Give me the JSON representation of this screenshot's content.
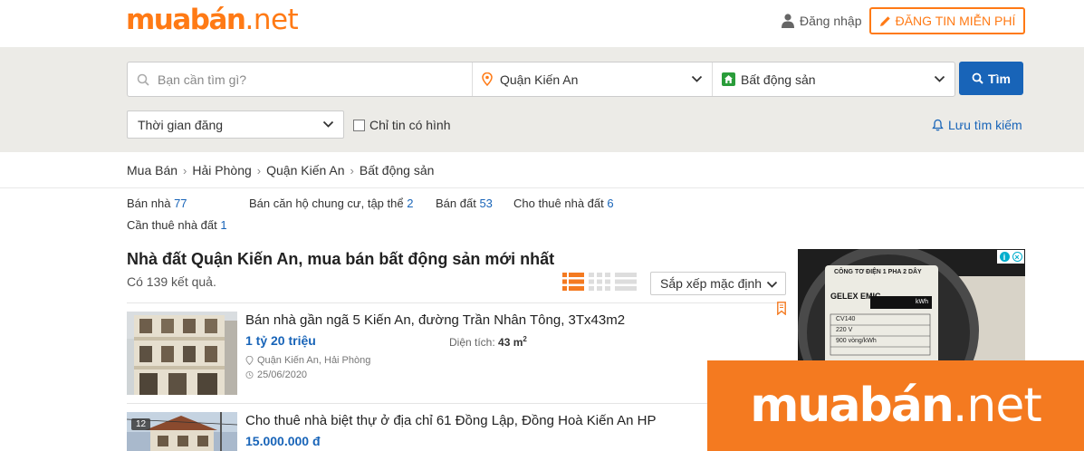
{
  "header": {
    "logo_main": "muabán",
    "logo_suffix": ".net",
    "login_label": "Đăng nhập",
    "post_button_label": "ĐĂNG TIN MIỄN PHÍ"
  },
  "search": {
    "placeholder": "Bạn cần tìm gì?",
    "location_value": "Quận Kiến An",
    "category_value": "Bất động sản",
    "search_button_label": "Tìm",
    "time_filter_value": "Thời gian đăng",
    "photo_only_label": "Chỉ tin có hình",
    "photo_only_checked": false,
    "save_search_label": "Lưu tìm kiếm"
  },
  "breadcrumb": [
    "Mua Bán",
    "Hải Phòng",
    "Quận Kiến An",
    "Bất động sản"
  ],
  "subcategories": [
    {
      "label": "Bán nhà",
      "count": "77"
    },
    {
      "label": "Bán căn hộ chung cư, tập thể",
      "count": "2"
    },
    {
      "label": "Bán đất",
      "count": "53"
    },
    {
      "label": "Cho thuê nhà đất",
      "count": "6"
    },
    {
      "label": "Cần thuê nhà đất",
      "count": "1"
    }
  ],
  "results": {
    "title": "Nhà đất Quận Kiến An, mua bán bất động sản mới nhất",
    "count_text": "Có 139 kết quả.",
    "sort_value": "Sắp xếp mặc định"
  },
  "listings": [
    {
      "title": "Bán nhà gần ngã 5 Kiến An, đường Trần Nhân Tông, 3Tx43m2",
      "price": "1 tỷ 20 triệu",
      "area_label": "Diện tích:",
      "area_value": "43 m",
      "area_unit_sup": "2",
      "location": "Quận Kiến An, Hải Phòng",
      "date": "25/06/2020"
    },
    {
      "title": "Cho thuê nhà biệt thự ở địa chỉ 61 Đồng Lập, Đồng Hoà Kiến An HP",
      "price": "15.000.000 đ",
      "photo_count": "12"
    }
  ],
  "ad": {
    "meter_lines": [
      "CÔNG TƠ ĐIỆN 1 PHA 2 DÂY",
      "GELEX EMIC",
      "CV140",
      "220 V",
      "900 vòng/kWh",
      "kWh"
    ]
  },
  "watermark": {
    "main": "muabán",
    "suffix": ".net"
  },
  "colors": {
    "brand_orange": "#ff7a15",
    "link_blue": "#1864b8",
    "search_band": "#ecebe7"
  }
}
